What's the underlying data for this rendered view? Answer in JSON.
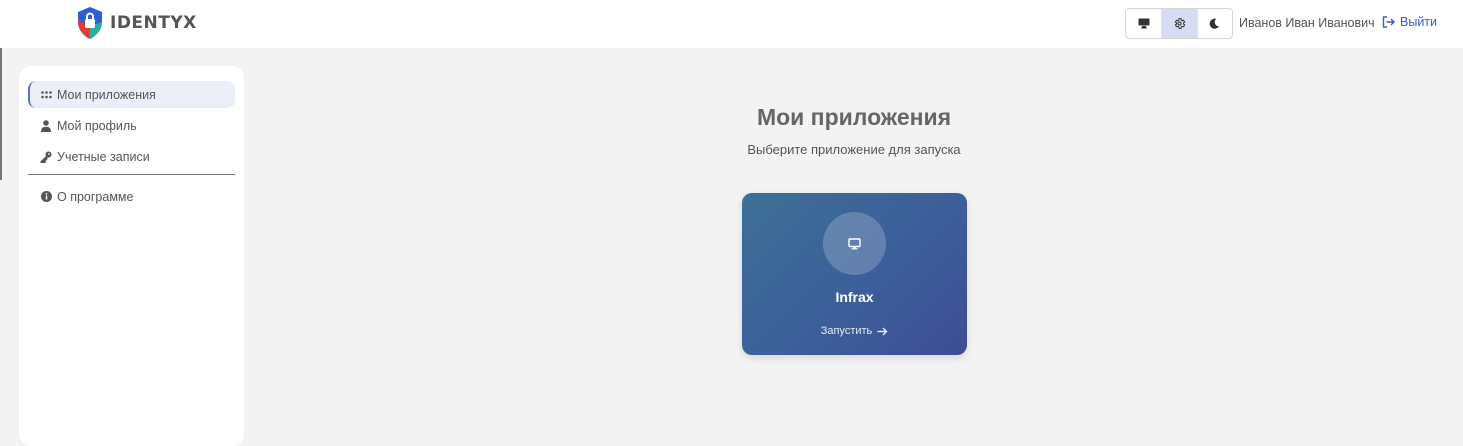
{
  "header": {
    "brand": "IDENTYX",
    "theme_buttons": [
      {
        "icon": "monitor-icon",
        "active": false
      },
      {
        "icon": "gear-icon",
        "active": true
      },
      {
        "icon": "moon-icon",
        "active": false
      }
    ],
    "user_name": "Иванов Иван Иванович",
    "logout_label": "Выйти"
  },
  "sidebar": {
    "items": [
      {
        "label": "Мои приложения",
        "icon": "apps-grid-icon",
        "active": true
      },
      {
        "label": "Мой профиль",
        "icon": "user-icon",
        "active": false
      },
      {
        "label": "Учетные записи",
        "icon": "key-icon",
        "active": false
      }
    ],
    "footer_items": [
      {
        "label": "О программе",
        "icon": "info-icon"
      }
    ]
  },
  "main": {
    "title": "Мои приложения",
    "subtitle": "Выберите приложение для запуска",
    "apps": [
      {
        "name": "Infrax",
        "icon": "monitor-icon",
        "launch_label": "Запустить"
      }
    ]
  },
  "colors": {
    "accent": "#3b5bc6",
    "card_gradient_start": "#3d7098",
    "card_gradient_end": "#3d4d94",
    "active_theme_bg": "#d6dcf3"
  }
}
